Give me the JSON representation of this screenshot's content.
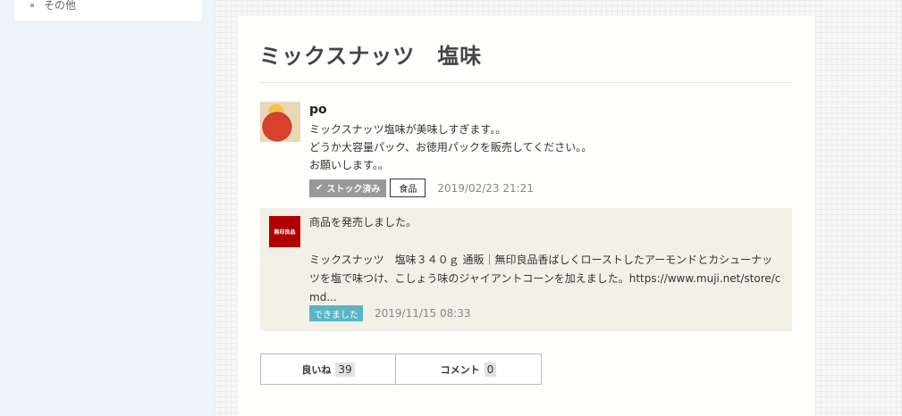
{
  "sidebar": {
    "items": [
      {
        "label": "その他"
      }
    ]
  },
  "page": {
    "title": "ミックスナッツ　塩味"
  },
  "post": {
    "author": "po",
    "body_lines": [
      "ミックスナッツ塩味が美味しすぎます。。",
      "どうか大容量パック、お徳用パックを販売してください。。",
      "お願いします。。"
    ],
    "stock_label": "ストック済み",
    "tag": "食品",
    "date": "2019/02/23 21:21"
  },
  "reply": {
    "logo_text": "無印良品",
    "line1": "商品を発売しました。",
    "line2": "ミックスナッツ　塩味３４０ｇ 通販｜無印良品香ばしくローストしたアーモンドとカシューナッ",
    "line3": "ツを塩で味つけ、こしょう味のジャイアントコーンを加えました。https://www.muji.net/store/c",
    "line4": "md...",
    "status": "できました",
    "date": "2019/11/15 08:33"
  },
  "actions": {
    "like_label": "良いね",
    "like_count": "39",
    "comment_label": "コメント",
    "comment_count": "0"
  },
  "colors": {
    "reply_bg": "#f3f1e7",
    "muji_red": "#b00000",
    "status_badge": "#5bb5c6",
    "stock_badge": "#999999"
  }
}
